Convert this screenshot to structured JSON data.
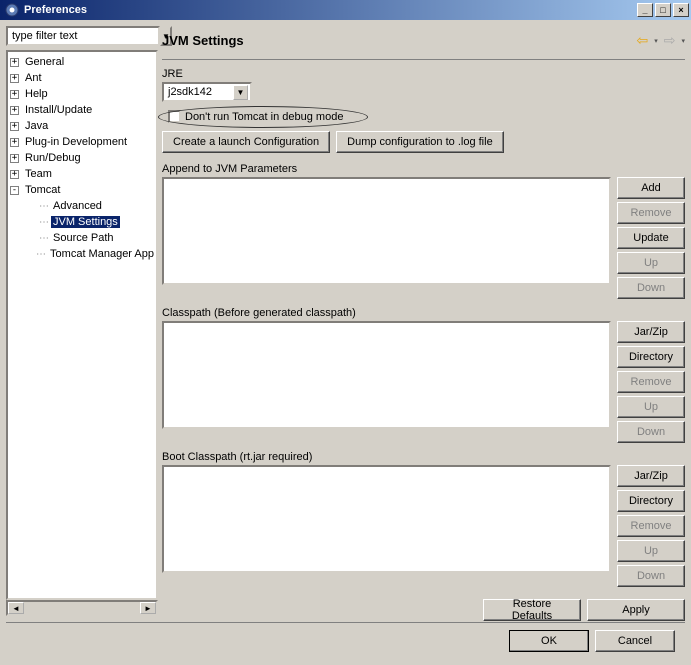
{
  "window": {
    "title": "Preferences"
  },
  "filter": {
    "placeholder": "type filter text"
  },
  "tree": {
    "items": [
      {
        "label": "General",
        "expandable": true,
        "depth": 0
      },
      {
        "label": "Ant",
        "expandable": true,
        "depth": 0
      },
      {
        "label": "Help",
        "expandable": true,
        "depth": 0
      },
      {
        "label": "Install/Update",
        "expandable": true,
        "depth": 0
      },
      {
        "label": "Java",
        "expandable": true,
        "depth": 0
      },
      {
        "label": "Plug-in Development",
        "expandable": true,
        "depth": 0
      },
      {
        "label": "Run/Debug",
        "expandable": true,
        "depth": 0
      },
      {
        "label": "Team",
        "expandable": true,
        "depth": 0
      },
      {
        "label": "Tomcat",
        "expandable": true,
        "expanded": true,
        "depth": 0
      },
      {
        "label": "Advanced",
        "expandable": false,
        "depth": 1
      },
      {
        "label": "JVM Settings",
        "expandable": false,
        "depth": 1,
        "selected": true
      },
      {
        "label": "Source Path",
        "expandable": false,
        "depth": 1
      },
      {
        "label": "Tomcat Manager App",
        "expandable": false,
        "depth": 1
      }
    ]
  },
  "page": {
    "title": "JVM Settings",
    "jre_label": "JRE",
    "jre_value": "j2sdk142",
    "debug_checkbox": "Don't run Tomcat in debug mode",
    "create_launch": "Create a launch Configuration",
    "dump_config": "Dump configuration to .log file",
    "sections": {
      "jvm_params": {
        "label": "Append to JVM Parameters",
        "buttons": {
          "add": "Add",
          "remove": "Remove",
          "update": "Update",
          "up": "Up",
          "down": "Down"
        }
      },
      "classpath": {
        "label": "Classpath (Before generated classpath)",
        "buttons": {
          "jarzip": "Jar/Zip",
          "directory": "Directory",
          "remove": "Remove",
          "up": "Up",
          "down": "Down"
        }
      },
      "bootclasspath": {
        "label": "Boot Classpath (rt.jar required)",
        "buttons": {
          "jarzip": "Jar/Zip",
          "directory": "Directory",
          "remove": "Remove",
          "up": "Up",
          "down": "Down"
        }
      }
    },
    "restore_defaults": "Restore Defaults",
    "apply": "Apply"
  },
  "dialog": {
    "ok": "OK",
    "cancel": "Cancel"
  }
}
